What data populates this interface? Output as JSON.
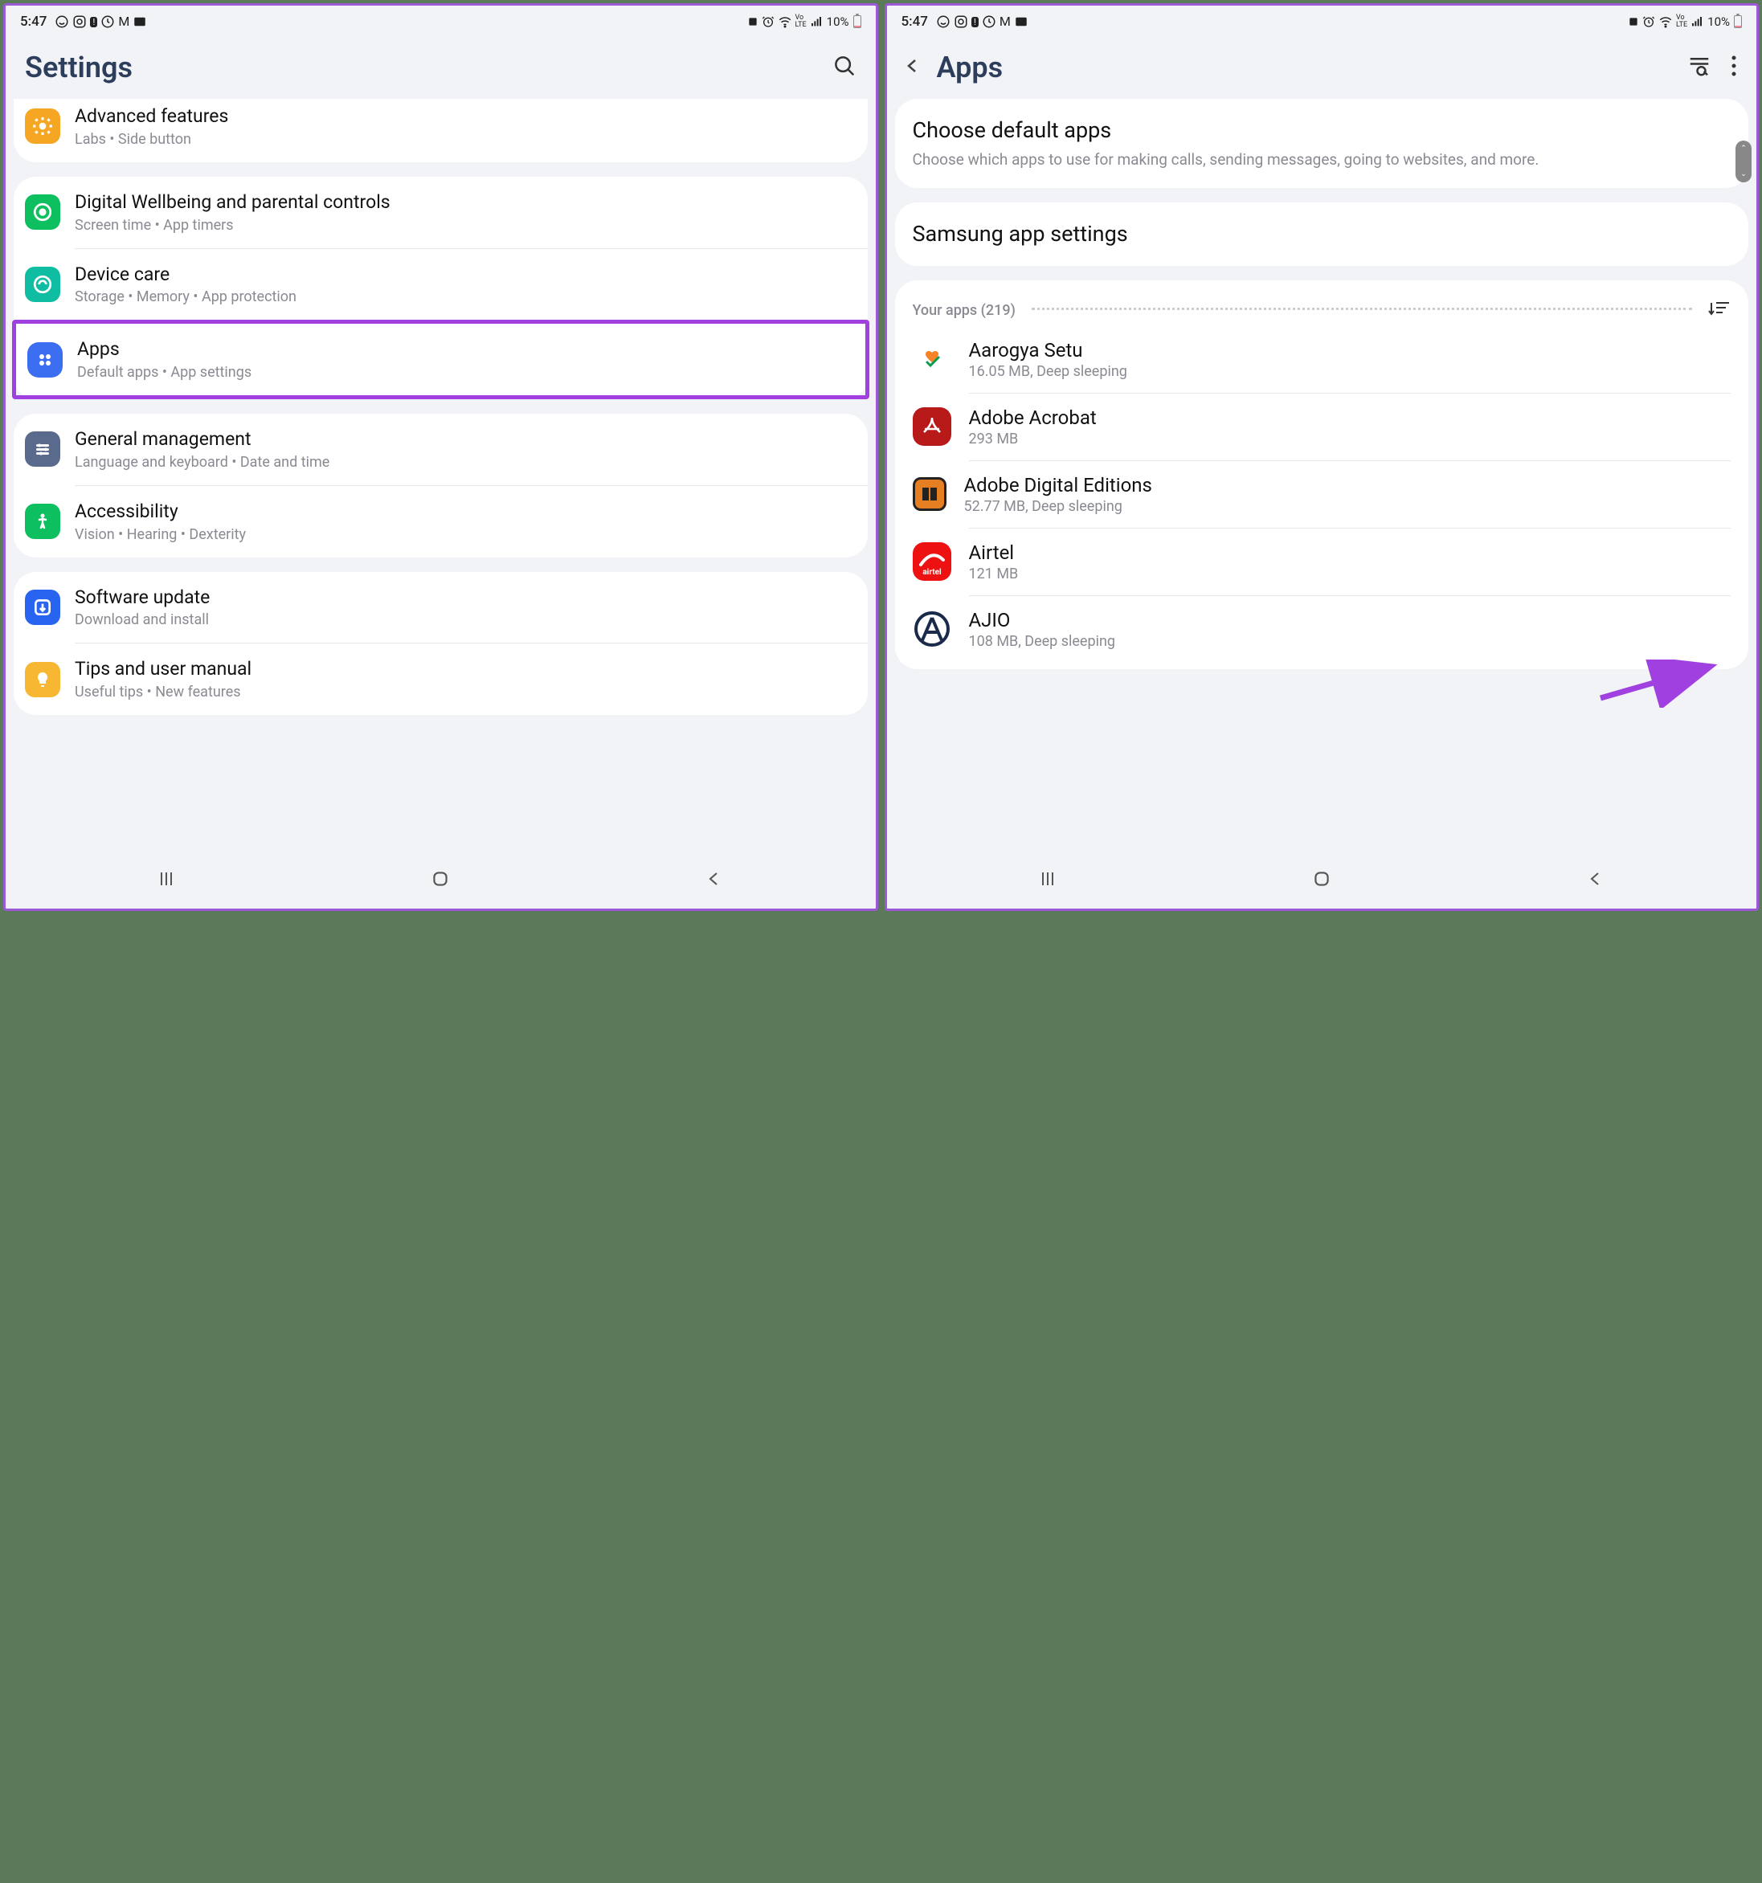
{
  "status": {
    "time": "5:47",
    "battery": "10%"
  },
  "left": {
    "title": "Settings",
    "items": [
      {
        "title": "Advanced features",
        "sub": "Labs  •  Side button",
        "icon": "advanced",
        "color": "ico-orange"
      },
      {
        "title": "Digital Wellbeing and parental controls",
        "sub": "Screen time  •  App timers",
        "icon": "wellbeing",
        "color": "ico-green"
      },
      {
        "title": "Device care",
        "sub": "Storage  •  Memory  •  App protection",
        "icon": "devicecare",
        "color": "ico-teal"
      },
      {
        "title": "Apps",
        "sub": "Default apps  •  App settings",
        "icon": "apps",
        "color": "ico-blue",
        "highlighted": true
      },
      {
        "title": "General management",
        "sub": "Language and keyboard  •  Date and time",
        "icon": "general",
        "color": "ico-slate"
      },
      {
        "title": "Accessibility",
        "sub": "Vision  •  Hearing  •  Dexterity",
        "icon": "accessibility",
        "color": "ico-green2"
      },
      {
        "title": "Software update",
        "sub": "Download and install",
        "icon": "swupdate",
        "color": "ico-bluesq"
      },
      {
        "title": "Tips and user manual",
        "sub": "Useful tips  •  New features",
        "icon": "tips",
        "color": "ico-yellow"
      }
    ]
  },
  "right": {
    "title": "Apps",
    "default_apps": {
      "title": "Choose default apps",
      "sub": "Choose which apps to use for making calls, sending messages, going to websites, and more."
    },
    "samsung": "Samsung app settings",
    "your_apps_label": "Your apps (219)",
    "apps": [
      {
        "name": "Aarogya Setu",
        "sub": "16.05 MB, Deep sleeping",
        "color": "ico-aarogya"
      },
      {
        "name": "Adobe Acrobat",
        "sub": "293 MB",
        "color": "ico-acrobat"
      },
      {
        "name": "Adobe Digital Editions",
        "sub": "52.77 MB, Deep sleeping",
        "color": "ico-ade"
      },
      {
        "name": "Airtel",
        "sub": "121 MB",
        "color": "ico-airtel"
      },
      {
        "name": "AJIO",
        "sub": "108 MB, Deep sleeping",
        "color": "ico-ajio"
      }
    ]
  }
}
